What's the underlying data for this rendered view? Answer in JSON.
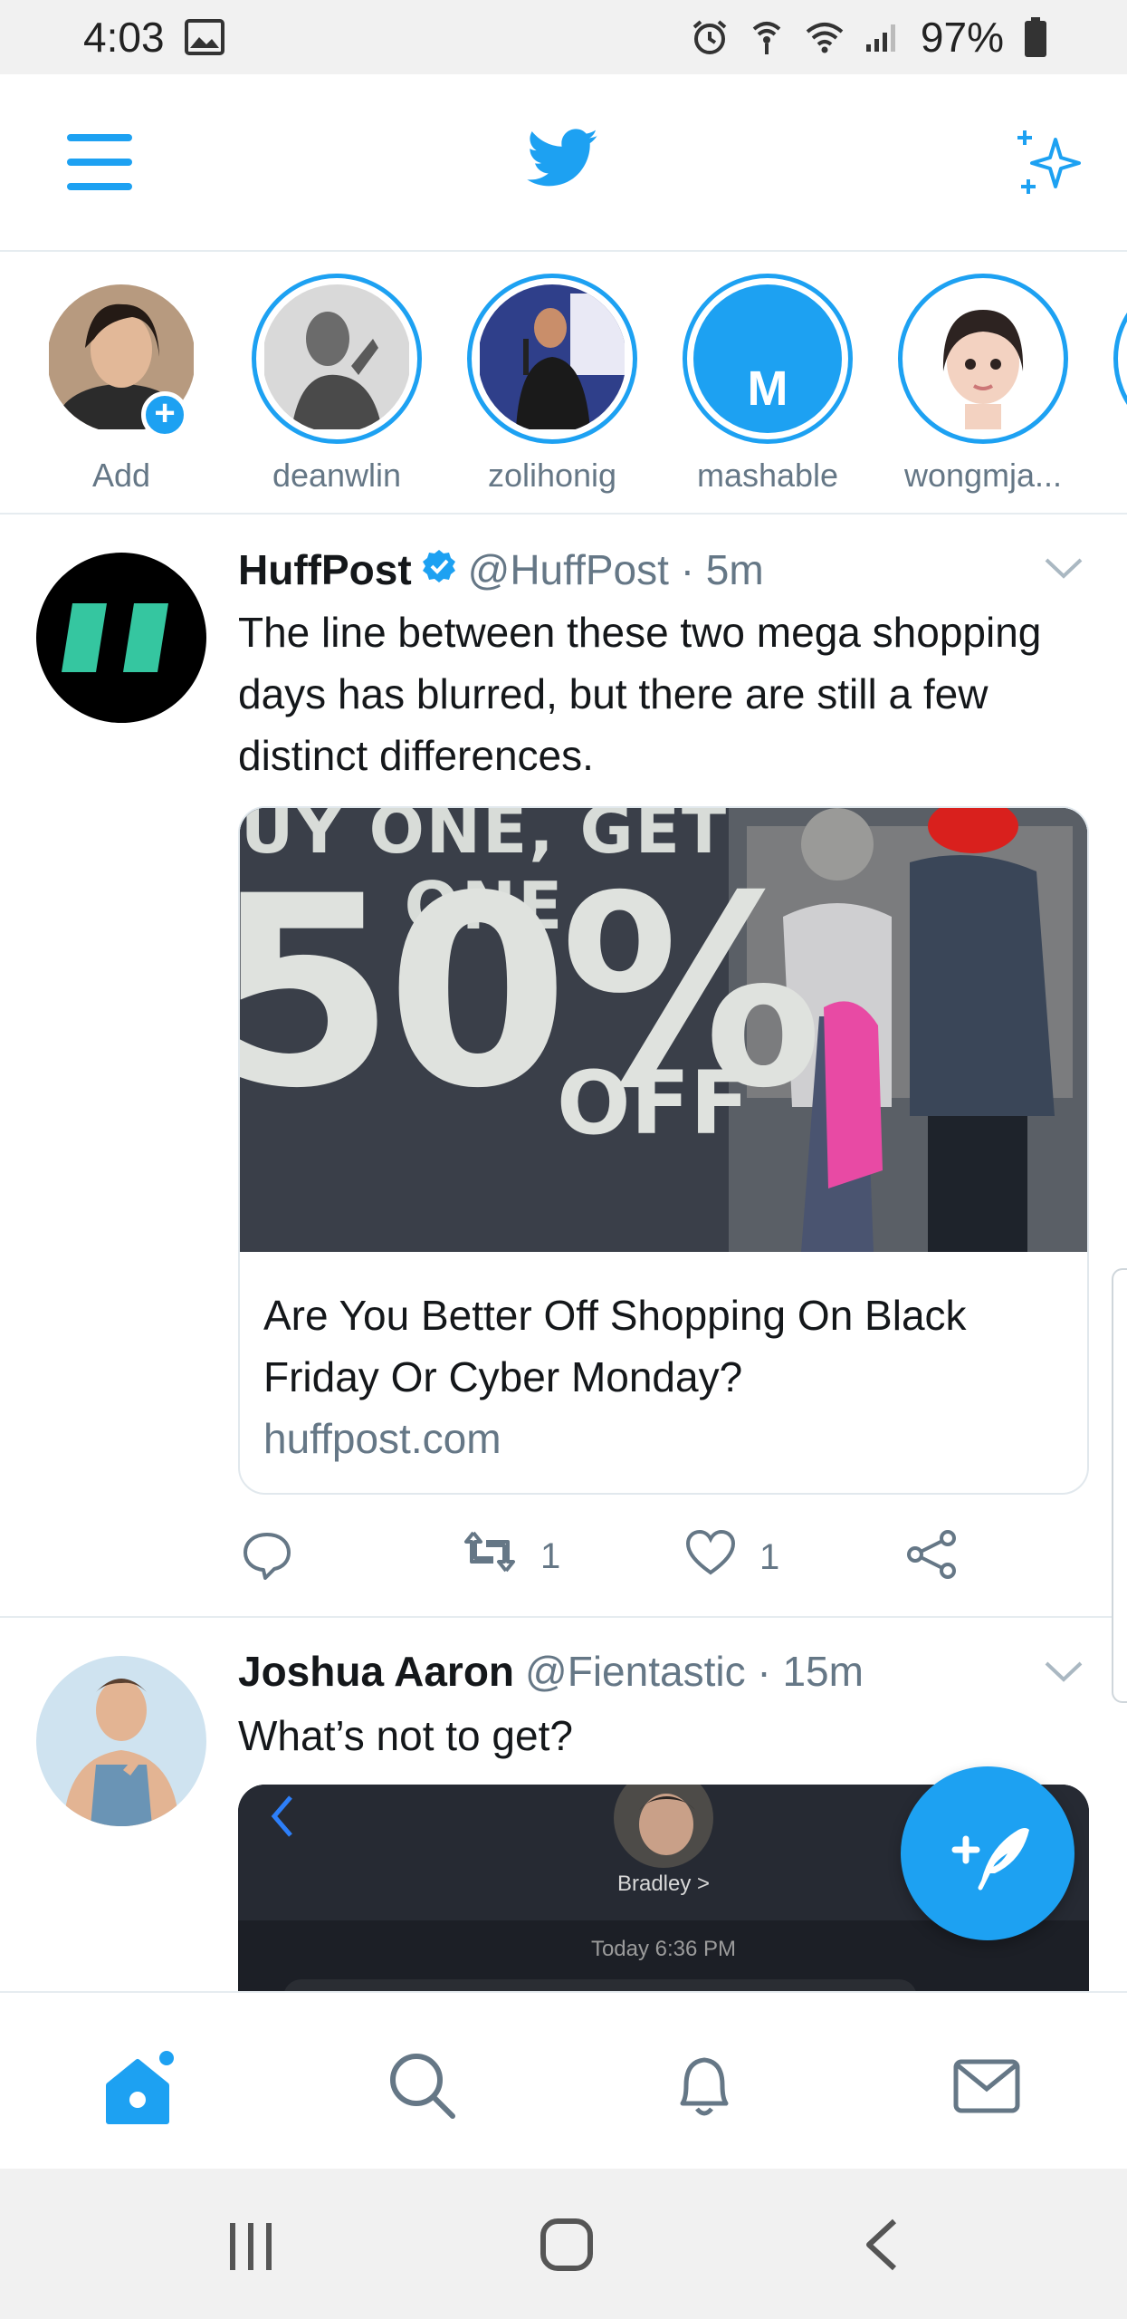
{
  "status_bar": {
    "time": "4:03",
    "battery": "97%"
  },
  "header": {
    "menu_icon": "hamburger-menu-icon",
    "logo_icon": "twitter-bird-icon",
    "sparkle_icon": "sparkle-icon"
  },
  "fleets": [
    {
      "label": "Add"
    },
    {
      "label": "deanwlin"
    },
    {
      "label": "zolihonig"
    },
    {
      "label": "mashable",
      "initial": "M"
    },
    {
      "label": "wongmja..."
    }
  ],
  "tweets": [
    {
      "name": "HuffPost",
      "meta": "@HuffPost · 5m",
      "text": "The line between these two mega shopping days has blurred, but there are still a few distinct differences.",
      "card": {
        "title": "Are You Better Off Shopping On Black Friday Or Cyber Monday?",
        "domain": "huffpost.com",
        "image_text_top": "UY ONE, GET ONE",
        "image_text_big": "50%",
        "image_text_off": "OFF"
      },
      "actions": {
        "retweets": "1",
        "likes": "1"
      }
    },
    {
      "name": "Joshua Aaron",
      "meta": "@Fientastic · 15m",
      "text": "What’s not to get?",
      "media": {
        "contact": "Bradley >",
        "timestamp": "Today 6:36 PM"
      }
    }
  ],
  "colors": {
    "accent": "#1da1f2",
    "text": "#14171a",
    "muted": "#657786"
  }
}
